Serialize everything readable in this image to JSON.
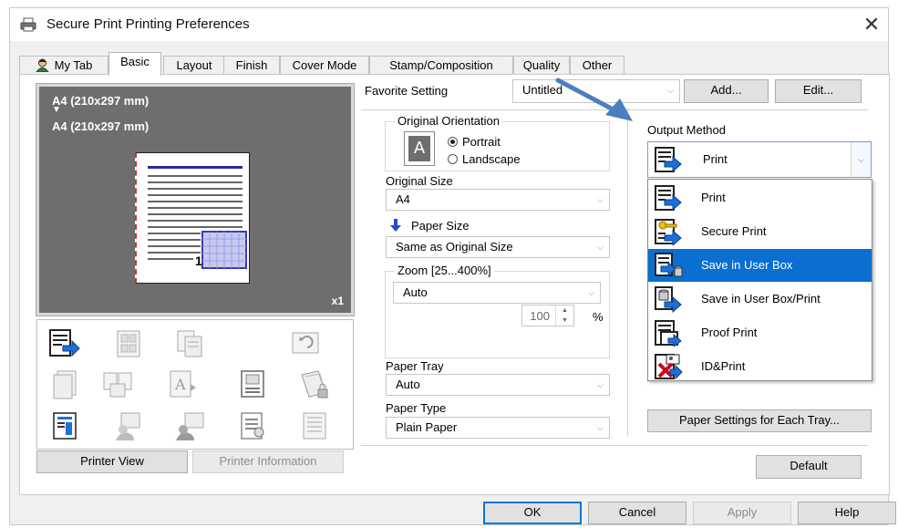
{
  "window": {
    "title": "Secure Print Printing Preferences",
    "close_glyph": "✕"
  },
  "tabs": [
    {
      "label": "My Tab",
      "icon": "user-icon"
    },
    {
      "label": "Basic",
      "active": true
    },
    {
      "label": "Layout"
    },
    {
      "label": "Finish"
    },
    {
      "label": "Cover Mode"
    },
    {
      "label": "Stamp/Composition"
    },
    {
      "label": "Quality"
    },
    {
      "label": "Other"
    }
  ],
  "preview": {
    "paper_top_label": "A4 (210x297 mm)",
    "paper_bottom_label": "A4 (210x297 mm)",
    "down_arrow": "▼",
    "copies_badge": "x1",
    "page_number": "1"
  },
  "preview_buttons": {
    "printer_view": "Printer View",
    "printer_information": "Printer Information"
  },
  "favorite": {
    "label": "Favorite Setting",
    "value": "Untitled",
    "add": "Add...",
    "edit": "Edit..."
  },
  "orientation": {
    "title": "Original Orientation",
    "portrait": "Portrait",
    "landscape": "Landscape",
    "selected": "Portrait",
    "icon_letter": "A"
  },
  "original_size": {
    "label": "Original Size",
    "value": "A4"
  },
  "paper_size": {
    "label": "Paper Size",
    "value": "Same as Original Size"
  },
  "zoom": {
    "title": "Zoom [25...400%]",
    "value": "Auto",
    "percent_value": "100",
    "percent_unit": "%"
  },
  "paper_tray": {
    "label": "Paper Tray",
    "value": "Auto"
  },
  "paper_type": {
    "label": "Paper Type",
    "value": "Plain Paper"
  },
  "output_method": {
    "label": "Output Method",
    "current": "Print",
    "options": [
      {
        "label": "Print",
        "icon": "print-icon"
      },
      {
        "label": "Secure Print",
        "icon": "secure-print-icon"
      },
      {
        "label": "Save in User Box",
        "icon": "save-user-box-icon",
        "selected": true
      },
      {
        "label": "Save in User Box/Print",
        "icon": "save-user-box-print-icon"
      },
      {
        "label": "Proof Print",
        "icon": "proof-print-icon"
      },
      {
        "label": "ID&Print",
        "icon": "id-print-icon"
      }
    ]
  },
  "paper_settings_button": "Paper Settings for Each Tray...",
  "default_button": "Default",
  "footer": {
    "ok": "OK",
    "cancel": "Cancel",
    "apply": "Apply",
    "help": "Help"
  },
  "colors": {
    "accent": "#0a6fd1",
    "highlight_arrow": "#4a7fc1",
    "preview_bg": "#6e6e6e"
  }
}
